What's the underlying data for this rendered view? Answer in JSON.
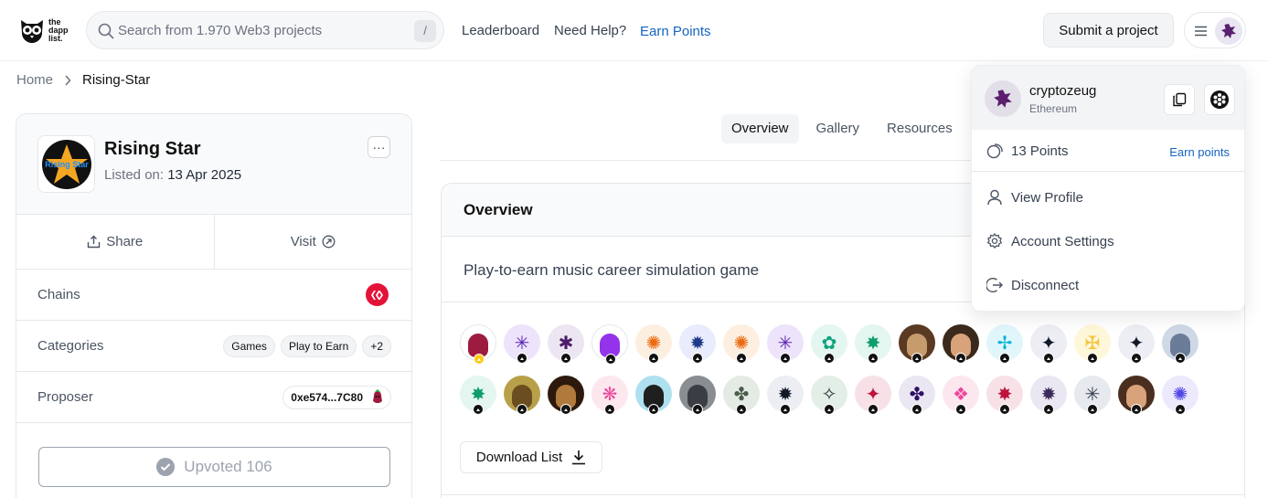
{
  "header": {
    "logo_lines": [
      "the",
      "dapp",
      "list."
    ],
    "search_placeholder": "Search from 1.970 Web3 projects",
    "search_shortcut": "/",
    "nav": [
      {
        "label": "Leaderboard"
      },
      {
        "label": "Need Help?"
      },
      {
        "label": "Earn Points"
      }
    ],
    "submit_label": "Submit a project"
  },
  "breadcrumb": {
    "home": "Home",
    "current": "Rising-Star"
  },
  "project": {
    "logo_text": "Rising Star",
    "name": "Rising Star",
    "listed_label": "Listed on:",
    "listed_date": "13 Apr 2025",
    "more_label": "···",
    "share_label": "Share",
    "visit_label": "Visit",
    "chains_label": "Chains",
    "chain_icon": "hive-icon",
    "categories_label": "Categories",
    "categories": [
      "Games",
      "Play to Earn",
      "+2"
    ],
    "proposer_label": "Proposer",
    "proposer_address": "0xe574...7C80",
    "upvote_label": "Upvoted 106"
  },
  "tabs": [
    {
      "label": "Overview",
      "active": true
    },
    {
      "label": "Gallery",
      "active": false
    },
    {
      "label": "Resources",
      "active": false
    }
  ],
  "overview": {
    "title": "Overview",
    "description": "Play-to-earn music career simulation game",
    "download_label": "Download List",
    "avatars": [
      {
        "bg": "#ffffff",
        "glyph": "photo",
        "fg": "#9d1b3f",
        "badge": "p"
      },
      {
        "bg": "#ede3fb",
        "glyph": "✳",
        "fg": "#5b21b6"
      },
      {
        "bg": "#ebe6f2",
        "glyph": "✱",
        "fg": "#4c1d6b"
      },
      {
        "bg": "#ffffff",
        "glyph": "photo",
        "fg": "#9333ea"
      },
      {
        "bg": "#fdefe0",
        "glyph": "✺",
        "fg": "#ea6a10"
      },
      {
        "bg": "#e8ecfd",
        "glyph": "✹",
        "fg": "#1e3a8a"
      },
      {
        "bg": "#fdefe0",
        "glyph": "✺",
        "fg": "#ea6a10"
      },
      {
        "bg": "#ede3fb",
        "glyph": "✳",
        "fg": "#5b21b6"
      },
      {
        "bg": "#e3f6ef",
        "glyph": "✿",
        "fg": "#10a37f"
      },
      {
        "bg": "#e3f6ef",
        "glyph": "✸",
        "fg": "#0f9d6e"
      },
      {
        "bg": "#5a3a22",
        "glyph": "photo",
        "fg": "#c69c6d"
      },
      {
        "bg": "#3b2a1c",
        "glyph": "photo",
        "fg": "#d8a27a"
      },
      {
        "bg": "#e0f6fb",
        "glyph": "✢",
        "fg": "#06b6d4"
      },
      {
        "bg": "#eceef3",
        "glyph": "✦",
        "fg": "#111827"
      },
      {
        "bg": "#fef7d9",
        "glyph": "✠",
        "fg": "#f5c542"
      },
      {
        "bg": "#eceef3",
        "glyph": "✦",
        "fg": "#111827"
      },
      {
        "bg": "#cfd8e6",
        "glyph": "photo",
        "fg": "#6b7c99"
      },
      {
        "bg": "#e3f6ef",
        "glyph": "✸",
        "fg": "#0f9d6e"
      },
      {
        "bg": "#b8a04a",
        "glyph": "photo",
        "fg": "#6b4e1f"
      },
      {
        "bg": "#2d1a0d",
        "glyph": "photo",
        "fg": "#b07a3c"
      },
      {
        "bg": "#fde7ef",
        "glyph": "❋",
        "fg": "#ec4899"
      },
      {
        "bg": "#aee0f0",
        "glyph": "photo",
        "fg": "#1f1f1f"
      },
      {
        "bg": "#8a8d92",
        "glyph": "photo",
        "fg": "#3a3d44"
      },
      {
        "bg": "#e4ebe4",
        "glyph": "✤",
        "fg": "#4a5d4a"
      },
      {
        "bg": "#eceef3",
        "glyph": "✹",
        "fg": "#111827"
      },
      {
        "bg": "#e3efe6",
        "glyph": "✧",
        "fg": "#1f2937"
      },
      {
        "bg": "#f7e1e7",
        "glyph": "✦",
        "fg": "#be123c"
      },
      {
        "bg": "#eae7f3",
        "glyph": "✤",
        "fg": "#2e1065"
      },
      {
        "bg": "#fde7ef",
        "glyph": "❖",
        "fg": "#ec4899"
      },
      {
        "bg": "#f7e1e7",
        "glyph": "✸",
        "fg": "#be123c"
      },
      {
        "bg": "#eae7f3",
        "glyph": "✹",
        "fg": "#3b2a5c"
      },
      {
        "bg": "#e6e9ee",
        "glyph": "✳",
        "fg": "#374151"
      },
      {
        "bg": "#4a2e1f",
        "glyph": "photo",
        "fg": "#d8a27a"
      },
      {
        "bg": "#ece9fd",
        "glyph": "✺",
        "fg": "#4f46e5"
      }
    ]
  },
  "dropdown": {
    "username": "cryptozeug",
    "chain": "Ethereum",
    "points_label": "13 Points",
    "earn_label": "Earn points",
    "items": [
      {
        "label": "View Profile",
        "icon": "user-icon"
      },
      {
        "label": "Account Settings",
        "icon": "gear-icon"
      },
      {
        "label": "Disconnect",
        "icon": "logout-icon"
      }
    ]
  },
  "colors": {
    "accent": "#1565c0",
    "hive_red": "#e31337",
    "user_avatar": "#5b1f6e"
  }
}
